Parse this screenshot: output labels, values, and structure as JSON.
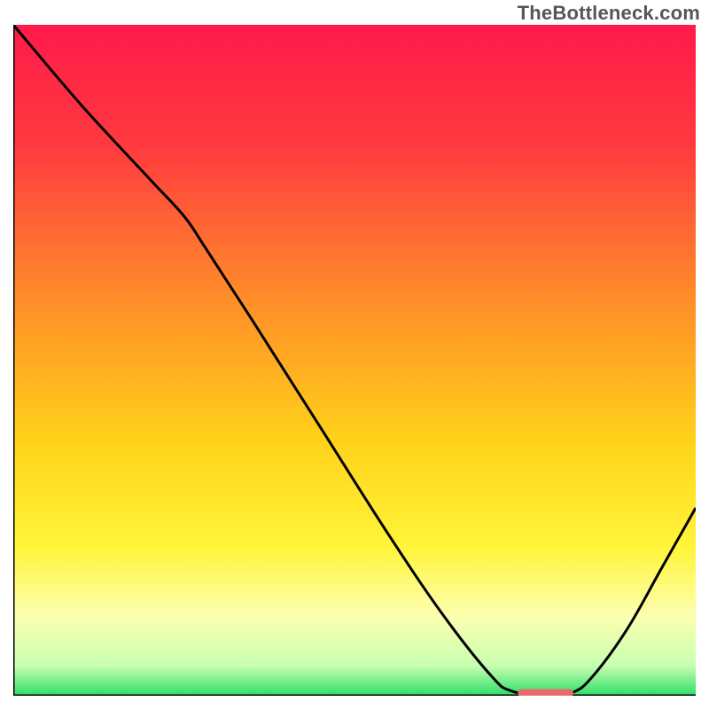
{
  "watermark": "TheBottleneck.com",
  "chart_data": {
    "type": "line",
    "title": "",
    "xlabel": "",
    "ylabel": "",
    "xlim": [
      0,
      100
    ],
    "ylim": [
      0,
      100
    ],
    "gradient_stops": [
      {
        "offset": 0.0,
        "color": "#ff1a4a"
      },
      {
        "offset": 0.18,
        "color": "#ff3a3f"
      },
      {
        "offset": 0.4,
        "color": "#ff8a29"
      },
      {
        "offset": 0.62,
        "color": "#ffd21a"
      },
      {
        "offset": 0.78,
        "color": "#fff53a"
      },
      {
        "offset": 0.88,
        "color": "#fdffb0"
      },
      {
        "offset": 0.955,
        "color": "#c9ffb0"
      },
      {
        "offset": 1.0,
        "color": "#2cde6a"
      }
    ],
    "curve_points": [
      {
        "x": 0.0,
        "y": 100.0
      },
      {
        "x": 10.0,
        "y": 88.0
      },
      {
        "x": 20.0,
        "y": 77.0
      },
      {
        "x": 25.0,
        "y": 71.5
      },
      {
        "x": 28.0,
        "y": 67.0
      },
      {
        "x": 35.0,
        "y": 56.0
      },
      {
        "x": 45.0,
        "y": 40.0
      },
      {
        "x": 55.0,
        "y": 24.0
      },
      {
        "x": 63.0,
        "y": 12.0
      },
      {
        "x": 70.0,
        "y": 3.0
      },
      {
        "x": 73.0,
        "y": 0.7
      },
      {
        "x": 78.0,
        "y": 0.0
      },
      {
        "x": 82.0,
        "y": 0.5
      },
      {
        "x": 85.0,
        "y": 3.0
      },
      {
        "x": 90.0,
        "y": 10.0
      },
      {
        "x": 95.0,
        "y": 19.0
      },
      {
        "x": 100.0,
        "y": 28.0
      }
    ],
    "marker": {
      "x_start": 74.5,
      "x_end": 81.5,
      "y": 0.4,
      "color": "#e86a6a",
      "thickness": 9,
      "cap": "round"
    },
    "axes": {
      "left": {
        "x": 0.0
      },
      "bottom": {
        "y": 0.0
      }
    }
  }
}
